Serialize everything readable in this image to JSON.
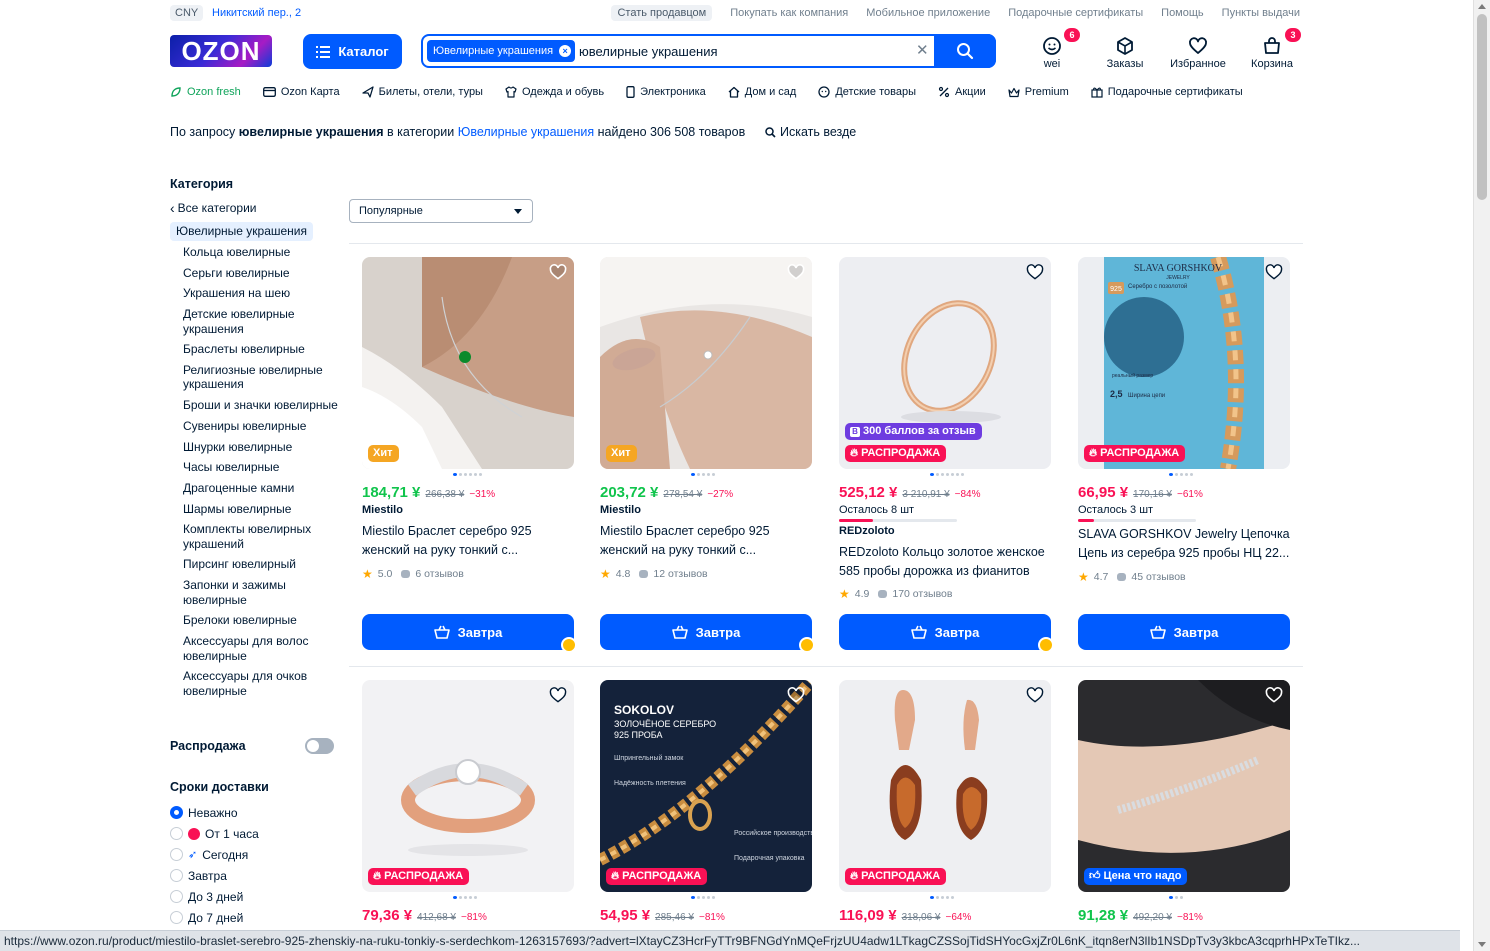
{
  "topbar": {
    "currency": "CNY",
    "address": "Никитский пер., 2",
    "links": [
      "Стать продавцом",
      "Покупать как компания",
      "Мобильное приложение",
      "Подарочные сертификаты",
      "Помощь",
      "Пункты выдачи"
    ]
  },
  "header": {
    "logo": "OZON",
    "catalog_label": "Каталог",
    "search_chip": "Ювелирные украшения",
    "search_value": "ювелирные украшения",
    "user_label": "wei",
    "user_badge": "6",
    "orders_label": "Заказы",
    "favorites_label": "Избранное",
    "cart_label": "Корзина",
    "cart_badge": "3"
  },
  "nav": [
    "Ozon fresh",
    "Ozon Карта",
    "Билеты, отели, туры",
    "Одежда и обувь",
    "Электроника",
    "Дом и сад",
    "Детские товары",
    "Акции",
    "Premium",
    "Подарочные сертификаты"
  ],
  "query": {
    "prefix": "По запросу ",
    "term": "ювелирные украшения",
    "mid": " в категории ",
    "category": "Ювелирные украшения",
    "suffix": " найдено 306 508 товаров",
    "search_everywhere": "Искать везде"
  },
  "sidebar": {
    "category_title": "Категория",
    "back": "Все категории",
    "current": "Ювелирные украшения",
    "items": [
      "Кольца ювелирные",
      "Серьги ювелирные",
      "Украшения на шею",
      "Детские ювелирные украшения",
      "Браслеты ювелирные",
      "Религиозные ювелирные украшения",
      "Броши и значки ювелирные",
      "Сувениры ювелирные",
      "Шнурки ювелирные",
      "Часы ювелирные",
      "Драгоценные камни",
      "Шармы ювелирные",
      "Комплекты ювелирных украшений",
      "Пирсинг ювелирный",
      "Запонки и зажимы ювелирные",
      "Брелоки ювелирные",
      "Аксессуары для волос ювелирные",
      "Аксессуары для очков ювелирные"
    ],
    "sale_label": "Распродажа",
    "delivery_title": "Сроки доставки",
    "delivery_options": [
      "Неважно",
      "От 1 часа",
      "Сегодня",
      "Завтра",
      "До 3 дней",
      "До 7 дней"
    ]
  },
  "sort": {
    "value": "Популярные"
  },
  "products": [
    {
      "tag": "Хит",
      "tag_type": "hit",
      "price": "184,71 ¥",
      "old": "266,38 ¥",
      "pct": "−31%",
      "brand": "Miestilo",
      "title": "Miestilo Браслет серебро 925 женский на руку тонкий с...",
      "rating": "5.0",
      "reviews": "6 отзывов",
      "button": "Завтра"
    },
    {
      "tag": "Хит",
      "tag_type": "hit",
      "price": "203,72 ¥",
      "old": "278,54 ¥",
      "pct": "−27%",
      "brand": "Miestilo",
      "title": "Miestilo Браслет серебро 925 женский на руку тонкий с...",
      "rating": "4.8",
      "reviews": "12 отзывов",
      "button": "Завтра"
    },
    {
      "tag": "РАСПРОДАЖА",
      "tag_type": "sale",
      "tag2": "300 баллов за отзыв",
      "price": "525,12 ¥",
      "old": "3 210,91 ¥",
      "pct": "−84%",
      "stock": "Осталось 8 шт",
      "brand": "REDzoloto",
      "title": "REDzoloto Кольцо золотое женское 585 пробы дорожка из фианитов",
      "rating": "4.9",
      "reviews": "170 отзывов",
      "button": "Завтра"
    },
    {
      "tag": "РАСПРОДАЖА",
      "tag_type": "sale",
      "price": "66,95 ¥",
      "old": "170,16 ¥",
      "pct": "−61%",
      "stock": "Осталось 3 шт",
      "title": "SLAVA GORSHKOV Jewelry Цепочка Цепь из серебра 925 пробы НЦ 22...",
      "rating": "4.7",
      "reviews": "45 отзывов",
      "button": "Завтра"
    },
    {
      "tag": "РАСПРОДАЖА",
      "tag_type": "sale",
      "price": "79,36 ¥",
      "old": "412,68 ¥",
      "pct": "−81%"
    },
    {
      "tag": "РАСПРОДАЖА",
      "tag_type": "sale",
      "price": "54,95 ¥",
      "old": "285,46 ¥",
      "pct": "−81%"
    },
    {
      "tag": "РАСПРОДАЖА",
      "tag_type": "sale",
      "price": "116,09 ¥",
      "old": "318,06 ¥",
      "pct": "−64%"
    },
    {
      "tag": "Цена что надо",
      "tag_type": "good",
      "price": "91,28 ¥",
      "old": "492,20 ¥",
      "pct": "−81%"
    }
  ],
  "image_text": {
    "slava_brand": "SLAVA GORSHKOV",
    "slava_sub": "JEWELRY",
    "slava_925": "925",
    "slava_silver": "Серебро с позолотой",
    "slava_width_num": "2,5",
    "slava_width": "Ширина цепи",
    "slava_real": "реальный размер",
    "sokolov_brand": "SOKOLOV",
    "sokolov_l1": "ЗОЛОЧЁНОЕ СЕРЕБРО",
    "sokolov_l2": "925 ПРОБА",
    "sokolov_f1": "Шпрингельный замок",
    "sokolov_f2": "Надёжность плетения",
    "sokolov_f3": "Российское производство",
    "sokolov_f4": "Подарочная упаковка"
  },
  "status_url": "https://www.ozon.ru/product/miestilo-braslet-serebro-925-zhenskiy-na-ruku-tonkiy-s-serdechkom-1263157693/?advert=lXtayCZ3HcrFyTTr9BFNGdYnMQeFrjzUU4adw1LTkagCZSSojTidSHYocGxjZr0L6nK_itqn8erN3lIb1NSDpTv3y3kbcA3cqprhHPxTeTIkz...",
  "colors": {
    "brand_blue": "#005bff",
    "sale_pink": "#f91155",
    "price_green": "#10c44c"
  }
}
